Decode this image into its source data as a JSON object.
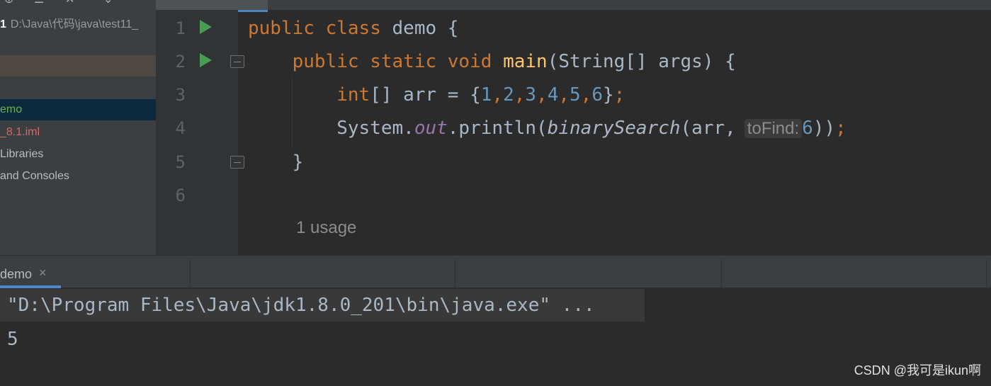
{
  "project": {
    "root_name": "1",
    "root_path": "D:\\Java\\代码\\java\\test11_",
    "items": [
      {
        "label": "emo"
      },
      {
        "label": "_8.1.iml"
      },
      {
        "label": "Libraries"
      },
      {
        "label": " and Consoles"
      }
    ]
  },
  "editor": {
    "lines": [
      "1",
      "2",
      "3",
      "4",
      "5",
      "6"
    ],
    "code": {
      "l1": {
        "kw1": "public",
        "kw2": "class",
        "name": "demo",
        "brace": "{"
      },
      "l2": {
        "kw1": "public",
        "kw2": "static",
        "kw3": "void",
        "method": "main",
        "params": "(String[] args) {"
      },
      "l3": {
        "type": "int",
        "decl": "[] arr = {",
        "n1": "1",
        "n2": "2",
        "n3": "3",
        "n4": "4",
        "n5": "5",
        "n6": "6",
        "close": "}",
        "semi": ";"
      },
      "l4": {
        "obj": "System.",
        "field": "out",
        "call": ".println(",
        "method": "binarySearch",
        "args": "(arr,",
        "hint": "toFind:",
        "value": "6",
        "close": "))",
        "semi": ";"
      },
      "l5": {
        "brace": "}"
      }
    },
    "usage_hint": "1 usage"
  },
  "run": {
    "tab_label": "demo",
    "tab_close": "×",
    "command": "\"D:\\Program Files\\Java\\jdk1.8.0_201\\bin\\java.exe\" ...",
    "output": "5"
  },
  "watermark": "CSDN @我可是ikun啊",
  "colors": {
    "keyword": "#cc7832",
    "number": "#6897bb",
    "method": "#ffc66d",
    "field": "#9876aa",
    "run_icon": "#499c54",
    "accent": "#4a88c7"
  }
}
